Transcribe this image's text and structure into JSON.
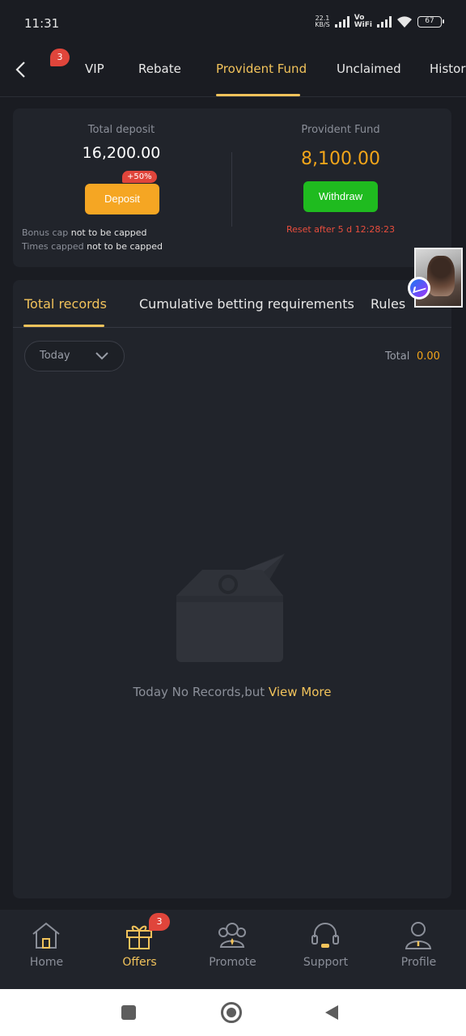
{
  "status_bar": {
    "time": "11:31",
    "net_speed_value": "22.1",
    "net_speed_unit": "KB/S",
    "vo_label": "Vo",
    "wifi_label": "WiFi",
    "battery": "67"
  },
  "tabs": {
    "badge": "3",
    "items": [
      "VIP",
      "Rebate",
      "Provident Fund",
      "Unclaimed",
      "History"
    ],
    "active": "Provident Fund"
  },
  "summary": {
    "deposit_label": "Total deposit",
    "deposit_amount": "16,200.00",
    "deposit_button": "Deposit",
    "bonus_tag": "+50%",
    "fund_label": "Provident Fund",
    "fund_amount": "8,100.00",
    "withdraw_button": "Withdraw",
    "bonus_cap_label": "Bonus cap",
    "bonus_cap_value": "not to be capped",
    "times_capped_label": "Times capped",
    "times_capped_value": "not to be capped",
    "reset_text": "Reset after 5 d 12:28:23"
  },
  "records": {
    "tabs": [
      "Total records",
      "Cumulative betting requirements",
      "Rules"
    ],
    "active_tab": "Total records",
    "date_filter": "Today",
    "total_label": "Total",
    "total_value": "0.00",
    "empty_text": "Today No Records,but",
    "empty_link": "View More"
  },
  "bottom_nav": {
    "items": [
      "Home",
      "Offers",
      "Promote",
      "Support",
      "Profile"
    ],
    "active": "Offers",
    "offers_badge": "3"
  },
  "colors": {
    "accent": "#f2c35b",
    "deposit_button": "#f5a623",
    "withdraw_button": "#1fbb1f",
    "badge": "#e0453b",
    "background": "#1a1c22",
    "card": "#21242b"
  }
}
